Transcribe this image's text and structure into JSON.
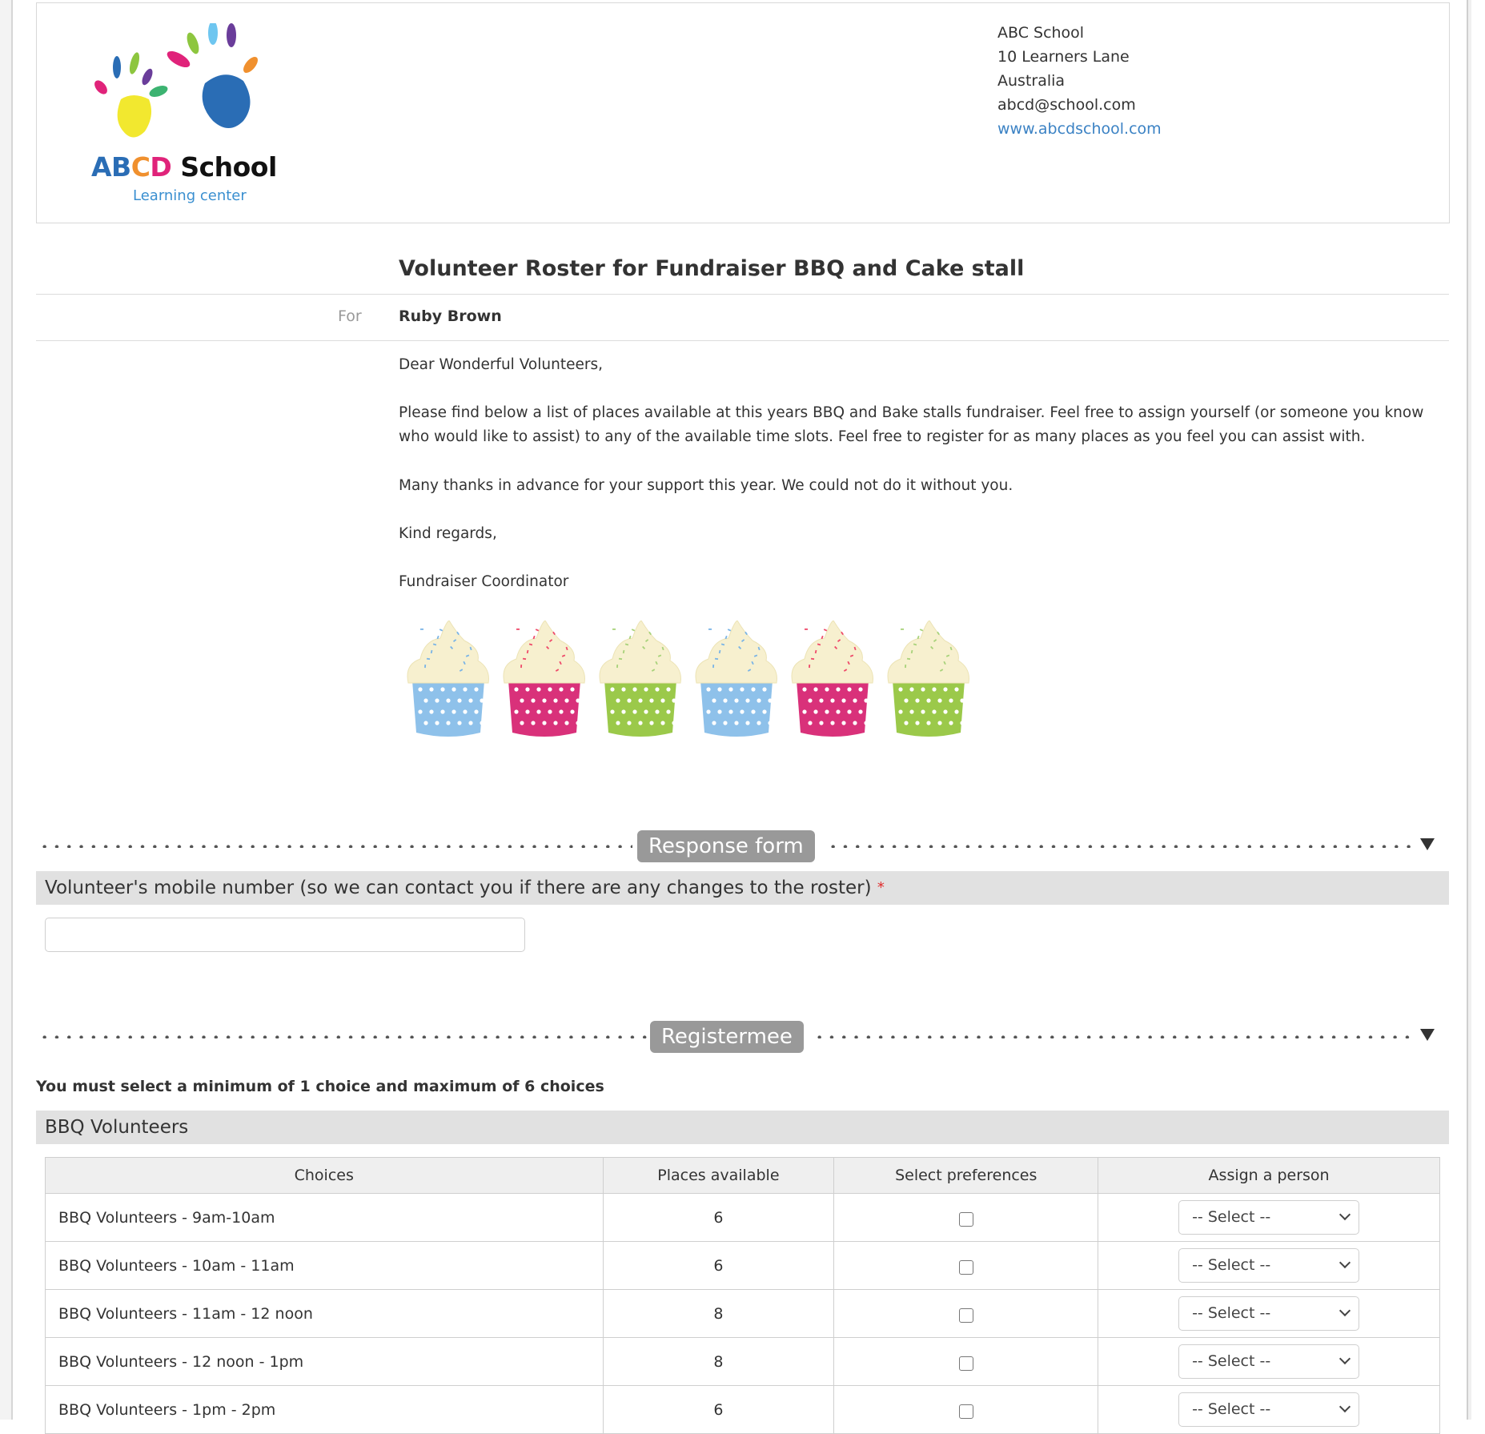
{
  "header": {
    "logo": {
      "title_letters": [
        {
          "ch": "A",
          "color": "#2a6db5"
        },
        {
          "ch": "B",
          "color": "#2a6db5"
        },
        {
          "ch": "C",
          "color": "#f0902e"
        },
        {
          "ch": "D",
          "color": "#e0237a"
        },
        {
          "ch": " School",
          "color": "#111111"
        }
      ],
      "subtitle": "Learning center"
    },
    "address": {
      "name": "ABC School",
      "street": "10 Learners Lane",
      "country": "Australia",
      "email": "abcd@school.com",
      "website": "www.abcdschool.com"
    }
  },
  "document": {
    "title": "Volunteer Roster for Fundraiser BBQ and Cake stall",
    "for_label": "For",
    "for_value": "Ruby Brown",
    "paragraphs": [
      "Dear Wonderful Volunteers,",
      "Please find below a list of places available at this years BBQ and Bake stalls fundraiser. Feel free to assign yourself (or someone you know who would like to assist) to any of the available time slots. Feel free to register for as many places as you feel you can assist with.",
      "Many thanks in advance for your support this year. We could not do it without you.",
      "Kind regards,",
      "Fundraiser Coordinator"
    ],
    "image": {
      "alt": "cupcakes",
      "cupcake_colors": [
        "#8ec1ea",
        "#d9317a",
        "#9bc94a",
        "#8ec1ea",
        "#d9317a",
        "#9bc94a"
      ],
      "sprinkle_colors": [
        "#7ab4e6",
        "#ef4a6a",
        "#a8d27a",
        "#7ab4e6",
        "#ef4a6a",
        "#a8d27a"
      ]
    }
  },
  "response_form": {
    "section_label": "Response form",
    "field_label": "Volunteer's mobile number (so we can contact you if there are any changes to the roster)",
    "required_marker": "*",
    "field_value": "",
    "field_placeholder": ""
  },
  "registermee": {
    "section_label": "Registermee",
    "constraint_text": "You must select a minimum of 1 choice and maximum of 6 choices",
    "group_label": "BBQ Volunteers",
    "columns": [
      "Choices",
      "Places available",
      "Select preferences",
      "Assign a person"
    ],
    "rows": [
      {
        "choice": "BBQ Volunteers - 9am-10am",
        "places": "6",
        "selected": false,
        "assign": "-- Select --"
      },
      {
        "choice": "BBQ Volunteers - 10am - 11am",
        "places": "6",
        "selected": false,
        "assign": "-- Select --"
      },
      {
        "choice": "BBQ Volunteers - 11am - 12 noon",
        "places": "8",
        "selected": false,
        "assign": "-- Select --"
      },
      {
        "choice": "BBQ Volunteers - 12 noon - 1pm",
        "places": "8",
        "selected": false,
        "assign": "-- Select --"
      },
      {
        "choice": "BBQ Volunteers - 1pm - 2pm",
        "places": "6",
        "selected": false,
        "assign": "-- Select --"
      }
    ]
  }
}
